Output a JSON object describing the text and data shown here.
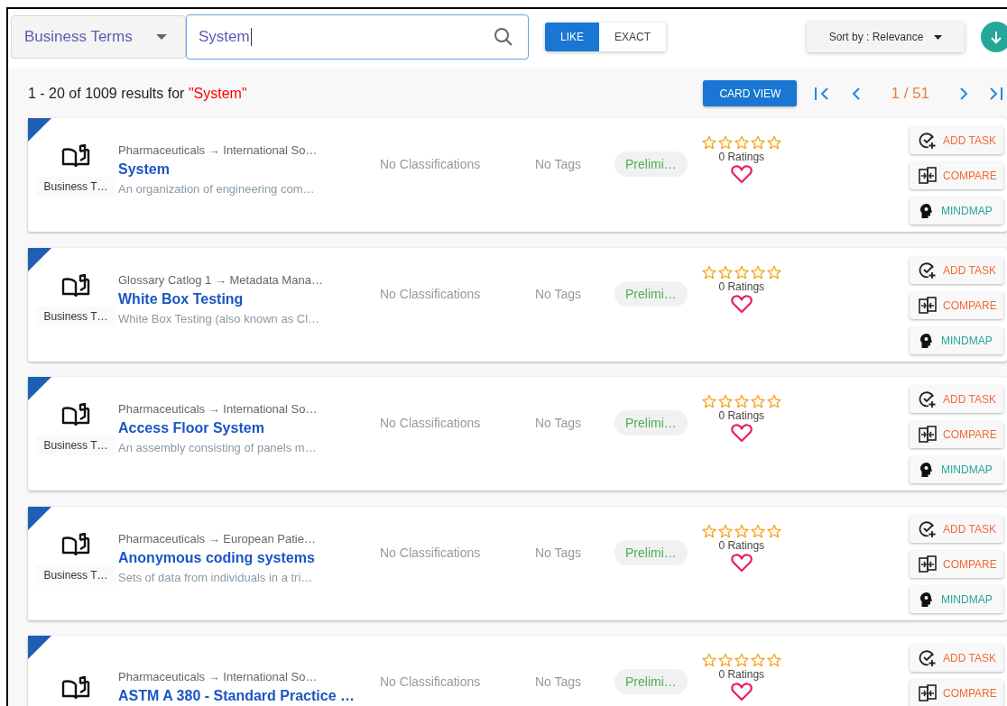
{
  "search_bar": {
    "category": "Business Terms",
    "query": "System",
    "match_modes": [
      {
        "label": "LIKE",
        "selected": true
      },
      {
        "label": "EXACT",
        "selected": false
      }
    ],
    "sort": "Sort by : Relevance"
  },
  "results_bar": {
    "summary": "1 - 20 of 1009 results for ",
    "query": "\"System\"",
    "view_button": "CARD VIEW",
    "page": "1 / 51"
  },
  "cards": [
    {
      "type_label": "Business T…",
      "path": "Pharmaceuticals → International So…",
      "title": "System",
      "description": "An organization of engineering com…",
      "classifications": "No Classifications",
      "tags": "No Tags",
      "status": "Prelimi…",
      "stars": 0,
      "ratings": "0 Ratings",
      "favorite": false,
      "actions": [
        {
          "kind": "task",
          "label": "ADD TASK"
        },
        {
          "kind": "compare",
          "label": "COMPARE"
        },
        {
          "kind": "mindmap",
          "label": "MINDMAP"
        }
      ]
    },
    {
      "type_label": "Business T…",
      "path": "Glossary Catlog 1 → Metadata Mana…",
      "title": "White Box Testing",
      "description": "White Box Testing (also known as Cl…",
      "classifications": "No Classifications",
      "tags": "No Tags",
      "status": "Prelimi…",
      "stars": 0,
      "ratings": "0 Ratings",
      "favorite": false,
      "actions": [
        {
          "kind": "task",
          "label": "ADD TASK"
        },
        {
          "kind": "compare",
          "label": "COMPARE"
        },
        {
          "kind": "mindmap",
          "label": "MINDMAP"
        }
      ]
    },
    {
      "type_label": "Business T…",
      "path": "Pharmaceuticals → International So…",
      "title": "Access Floor System",
      "description": "An assembly consisting of panels m…",
      "classifications": "No Classifications",
      "tags": "No Tags",
      "status": "Prelimi…",
      "stars": 0,
      "ratings": "0 Ratings",
      "favorite": false,
      "actions": [
        {
          "kind": "task",
          "label": "ADD TASK"
        },
        {
          "kind": "compare",
          "label": "COMPARE"
        },
        {
          "kind": "mindmap",
          "label": "MINDMAP"
        }
      ]
    },
    {
      "type_label": "Business T…",
      "path": "Pharmaceuticals → European Patie…",
      "title": "Anonymous coding systems",
      "description": "Sets of data from individuals in a tri…",
      "classifications": "No Classifications",
      "tags": "No Tags",
      "status": "Prelimi…",
      "stars": 0,
      "ratings": "0 Ratings",
      "favorite": false,
      "actions": [
        {
          "kind": "task",
          "label": "ADD TASK"
        },
        {
          "kind": "compare",
          "label": "COMPARE"
        },
        {
          "kind": "mindmap",
          "label": "MINDMAP"
        }
      ]
    },
    {
      "path": "Pharmaceuticals → International So…",
      "title": "ASTM A 380 - Standard Practice …",
      "classifications": "No Classifications",
      "tags": "No Tags",
      "status": "Prelimi…",
      "stars": 0,
      "ratings": "0 Ratings",
      "favorite": false,
      "actions": [
        {
          "kind": "task",
          "label": "ADD TASK"
        },
        {
          "kind": "compare",
          "label": "COMPARE"
        }
      ]
    }
  ]
}
